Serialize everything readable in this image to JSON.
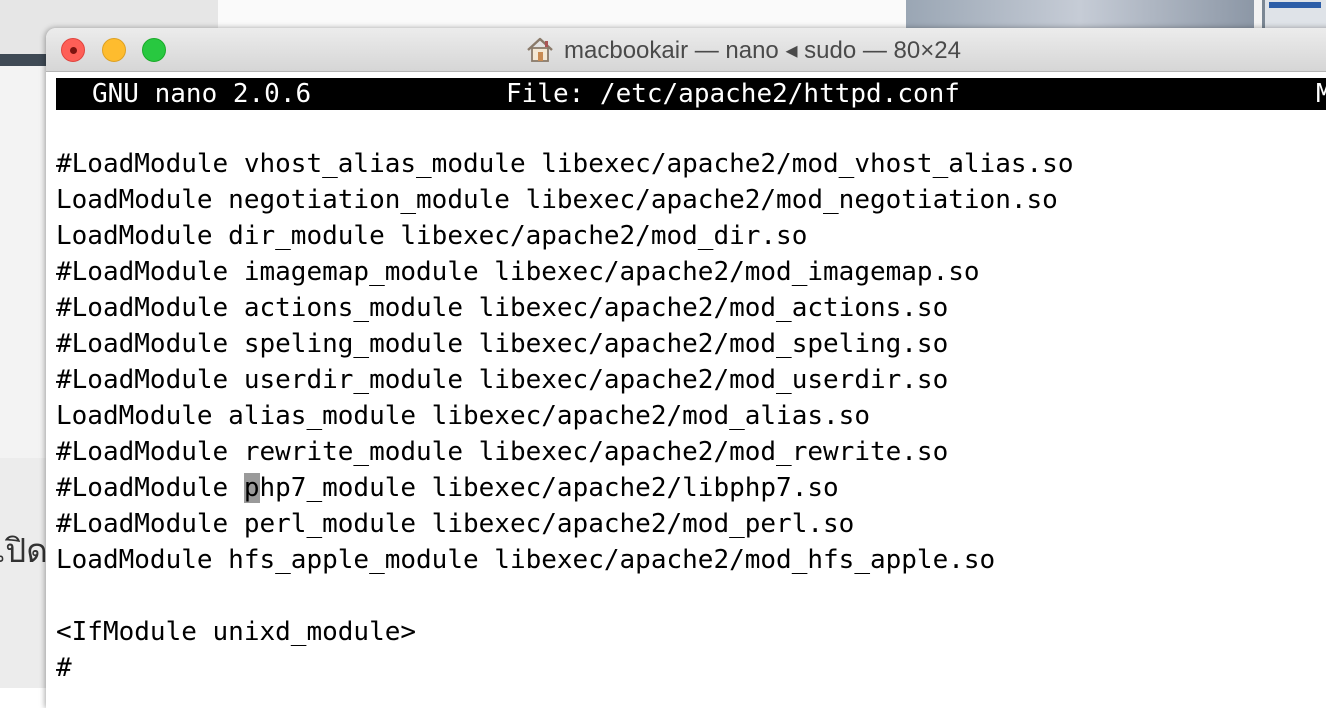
{
  "background": {
    "partial_text": "เปิด"
  },
  "window": {
    "title": "macbookair — nano ◂ sudo — 80×24",
    "icon": "home-icon",
    "buttons": {
      "close": "close-button",
      "minimize": "minimize-button",
      "zoom": "zoom-button"
    },
    "colors": {
      "close": "#fe5f57",
      "minimize": "#febc2e",
      "zoom": "#28c840"
    }
  },
  "nano": {
    "version": "GNU nano 2.0.6",
    "file": "File: /etc/apache2/httpd.conf",
    "status_right": "M"
  },
  "editor": {
    "lines": [
      "",
      "#LoadModule vhost_alias_module libexec/apache2/mod_vhost_alias.so",
      "LoadModule negotiation_module libexec/apache2/mod_negotiation.so",
      "LoadModule dir_module libexec/apache2/mod_dir.so",
      "#LoadModule imagemap_module libexec/apache2/mod_imagemap.so",
      "#LoadModule actions_module libexec/apache2/mod_actions.so",
      "#LoadModule speling_module libexec/apache2/mod_speling.so",
      "#LoadModule userdir_module libexec/apache2/mod_userdir.so",
      "LoadModule alias_module libexec/apache2/mod_alias.so",
      "#LoadModule rewrite_module libexec/apache2/mod_rewrite.so",
      "#LoadModule ",
      "#LoadModule perl_module libexec/apache2/mod_perl.so",
      "LoadModule hfs_apple_module libexec/apache2/mod_hfs_apple.so",
      "",
      "<IfModule unixd_module>",
      "#"
    ],
    "cursor_line": {
      "before": "#LoadModule ",
      "cursor_char": "p",
      "after": "hp7_module libexec/apache2/libphp7.so"
    }
  }
}
